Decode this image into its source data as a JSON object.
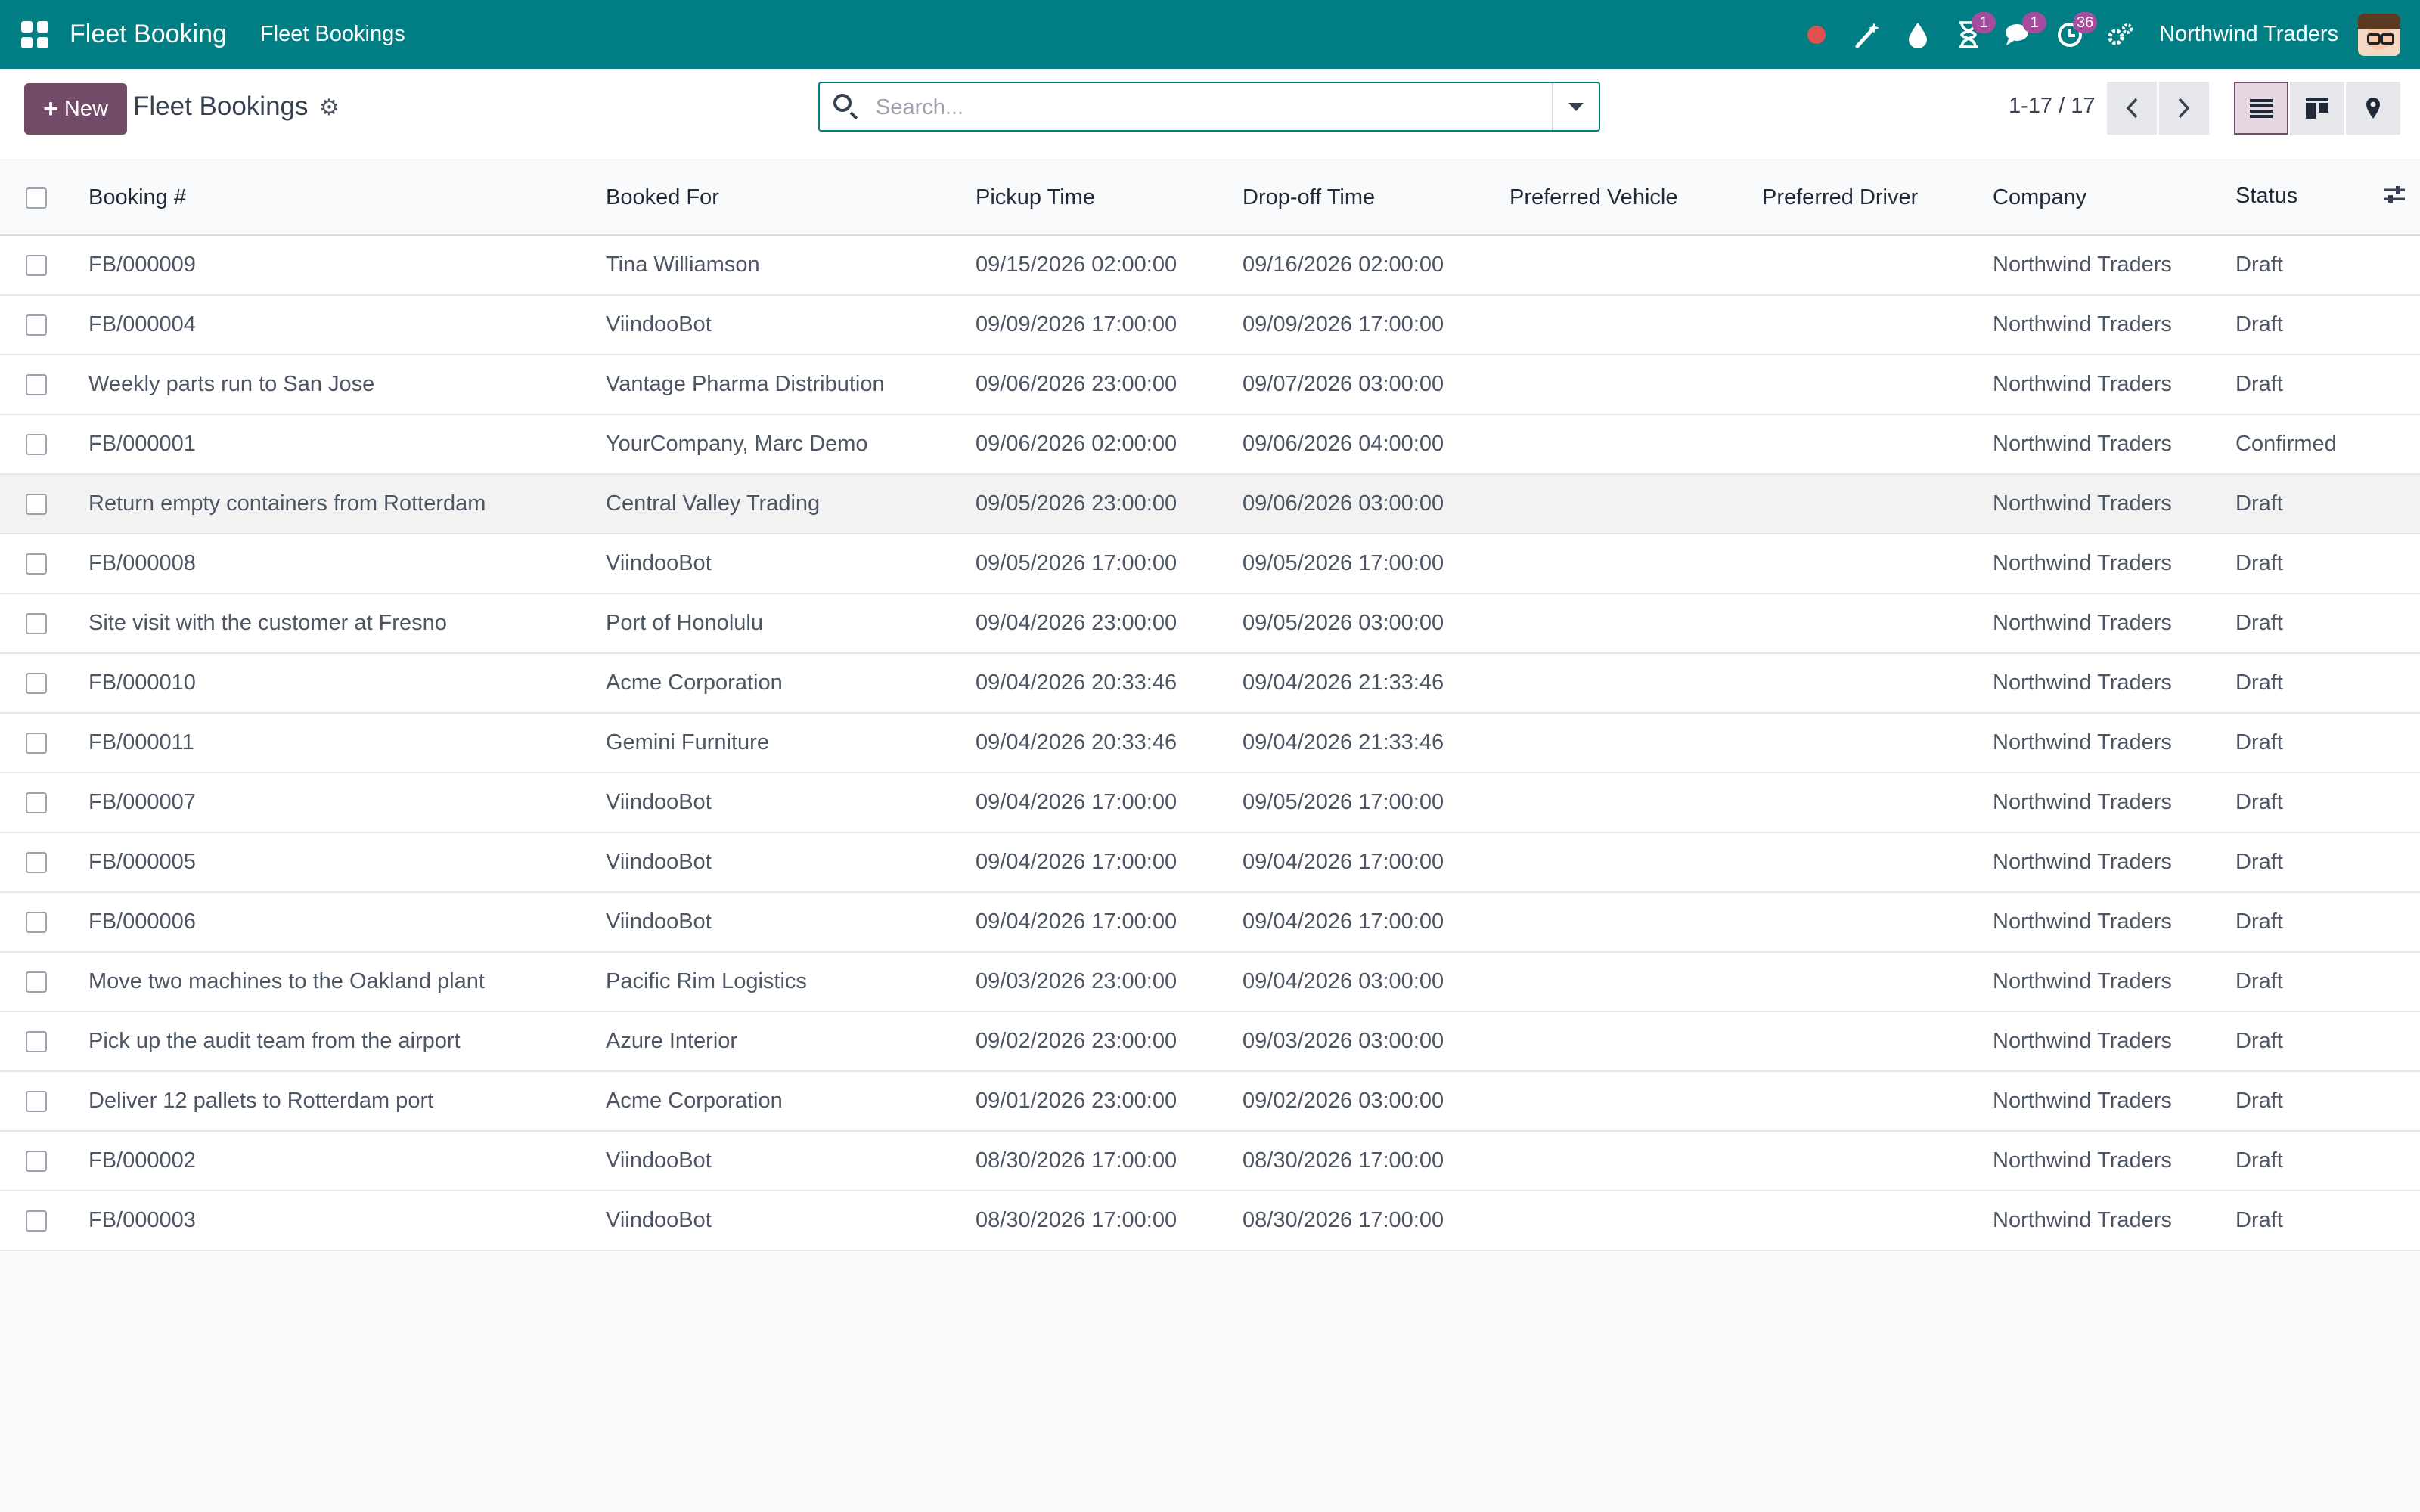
{
  "topbar": {
    "app_name": "Fleet Booking",
    "menu": [
      "Fleet Bookings"
    ],
    "systray": [
      {
        "icon": "recording-dot-icon",
        "badge": ""
      },
      {
        "icon": "magic-wand-icon",
        "badge": ""
      },
      {
        "icon": "droplet-icon",
        "badge": ""
      },
      {
        "icon": "hourglass-icon",
        "badge": "1"
      },
      {
        "icon": "chat-bubbles-icon",
        "badge": "1"
      },
      {
        "icon": "activity-clock-icon",
        "badge": "36"
      },
      {
        "icon": "settings-gears-icon",
        "badge": ""
      }
    ],
    "company": "Northwind Traders"
  },
  "control": {
    "new_label": "New",
    "title": "Fleet Bookings",
    "search_placeholder": "Search...",
    "pager": "1-17 / 17"
  },
  "table": {
    "columns": [
      "Booking #",
      "Booked For",
      "Pickup Time",
      "Drop-off Time",
      "Preferred Vehicle",
      "Preferred Driver",
      "Company",
      "Status"
    ],
    "rows": [
      [
        "FB/000009",
        "Tina Williamson",
        "09/15/2026 02:00:00",
        "09/16/2026 02:00:00",
        "",
        "",
        "Northwind Traders",
        "Draft"
      ],
      [
        "FB/000004",
        "ViindooBot",
        "09/09/2026 17:00:00",
        "09/09/2026 17:00:00",
        "",
        "",
        "Northwind Traders",
        "Draft"
      ],
      [
        "Weekly parts run to San Jose",
        "Vantage Pharma Distribution",
        "09/06/2026 23:00:00",
        "09/07/2026 03:00:00",
        "",
        "",
        "Northwind Traders",
        "Draft"
      ],
      [
        "FB/000001",
        "YourCompany, Marc Demo",
        "09/06/2026 02:00:00",
        "09/06/2026 04:00:00",
        "",
        "",
        "Northwind Traders",
        "Confirmed"
      ],
      [
        "Return empty containers from Rotterdam",
        "Central Valley Trading",
        "09/05/2026 23:00:00",
        "09/06/2026 03:00:00",
        "",
        "",
        "Northwind Traders",
        "Draft"
      ],
      [
        "FB/000008",
        "ViindooBot",
        "09/05/2026 17:00:00",
        "09/05/2026 17:00:00",
        "",
        "",
        "Northwind Traders",
        "Draft"
      ],
      [
        "Site visit with the customer at Fresno",
        "Port of Honolulu",
        "09/04/2026 23:00:00",
        "09/05/2026 03:00:00",
        "",
        "",
        "Northwind Traders",
        "Draft"
      ],
      [
        "FB/000010",
        "Acme Corporation",
        "09/04/2026 20:33:46",
        "09/04/2026 21:33:46",
        "",
        "",
        "Northwind Traders",
        "Draft"
      ],
      [
        "FB/000011",
        "Gemini Furniture",
        "09/04/2026 20:33:46",
        "09/04/2026 21:33:46",
        "",
        "",
        "Northwind Traders",
        "Draft"
      ],
      [
        "FB/000007",
        "ViindooBot",
        "09/04/2026 17:00:00",
        "09/05/2026 17:00:00",
        "",
        "",
        "Northwind Traders",
        "Draft"
      ],
      [
        "FB/000005",
        "ViindooBot",
        "09/04/2026 17:00:00",
        "09/04/2026 17:00:00",
        "",
        "",
        "Northwind Traders",
        "Draft"
      ],
      [
        "FB/000006",
        "ViindooBot",
        "09/04/2026 17:00:00",
        "09/04/2026 17:00:00",
        "",
        "",
        "Northwind Traders",
        "Draft"
      ],
      [
        "Move two machines to the Oakland plant",
        "Pacific Rim Logistics",
        "09/03/2026 23:00:00",
        "09/04/2026 03:00:00",
        "",
        "",
        "Northwind Traders",
        "Draft"
      ],
      [
        "Pick up the audit team from the airport",
        "Azure Interior",
        "09/02/2026 23:00:00",
        "09/03/2026 03:00:00",
        "",
        "",
        "Northwind Traders",
        "Draft"
      ],
      [
        "Deliver 12 pallets to Rotterdam port",
        "Acme Corporation",
        "09/01/2026 23:00:00",
        "09/02/2026 03:00:00",
        "",
        "",
        "Northwind Traders",
        "Draft"
      ],
      [
        "FB/000002",
        "ViindooBot",
        "08/30/2026 17:00:00",
        "08/30/2026 17:00:00",
        "",
        "",
        "Northwind Traders",
        "Draft"
      ],
      [
        "FB/000003",
        "ViindooBot",
        "08/30/2026 17:00:00",
        "08/30/2026 17:00:00",
        "",
        "",
        "Northwind Traders",
        "Draft"
      ]
    ],
    "highlighted_row": 4
  },
  "colors": {
    "topbar": "#017e84",
    "primary_button": "#714b67",
    "badge": "#a64c9e",
    "recording_dot": "#e0524f"
  }
}
